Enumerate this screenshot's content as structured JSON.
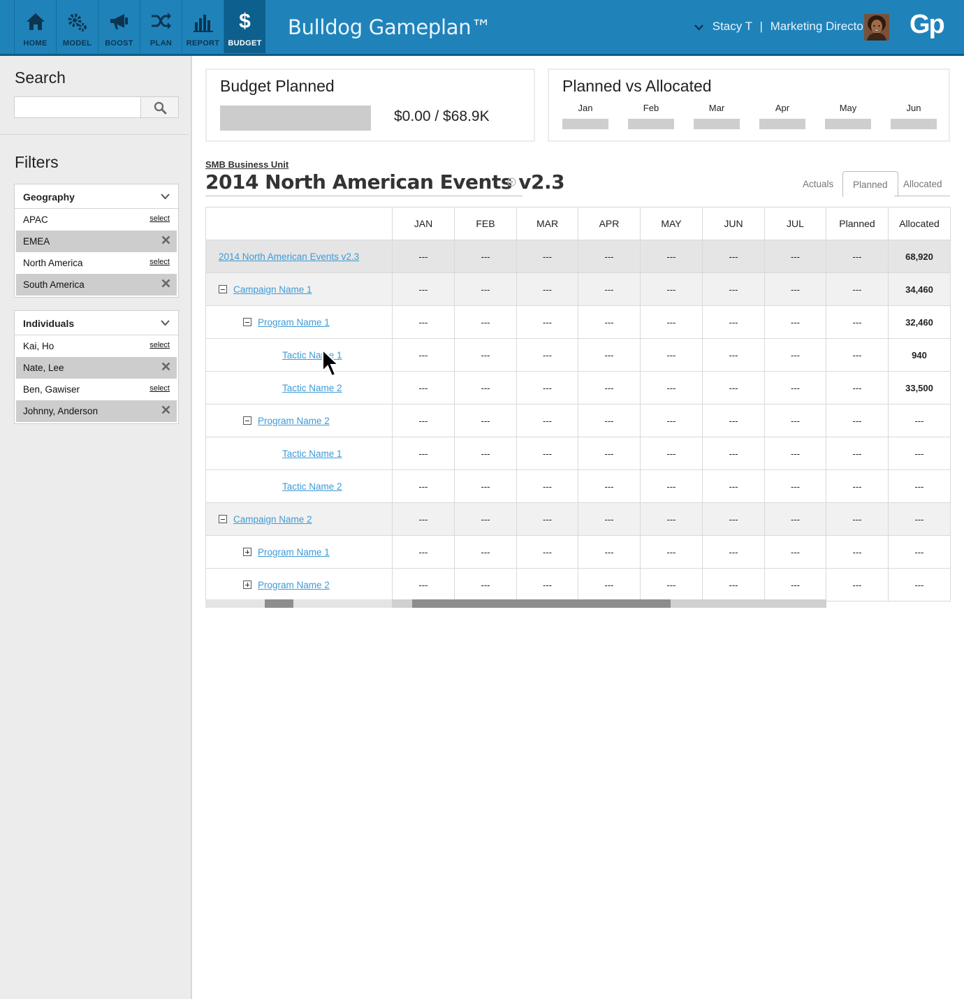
{
  "nav": {
    "items": [
      {
        "label": "HOME",
        "icon": "home-icon"
      },
      {
        "label": "MODEL",
        "icon": "gears-icon"
      },
      {
        "label": "BOOST",
        "icon": "megaphone-icon"
      },
      {
        "label": "PLAN",
        "icon": "shuffle-icon"
      },
      {
        "label": "REPORT",
        "icon": "bar-chart-icon"
      },
      {
        "label": "BUDGET",
        "icon": "dollar-icon"
      }
    ],
    "active": "BUDGET"
  },
  "header": {
    "app_title": "Bulldog Gameplan™",
    "user_name": "Stacy T",
    "separator": "|",
    "user_role": "Marketing Director",
    "logo": "Gp"
  },
  "sidebar": {
    "search_title": "Search",
    "search_placeholder": "",
    "filters_title": "Filters",
    "geography": {
      "title": "Geography",
      "items": [
        {
          "label": "APAC",
          "action": "select",
          "selected": false
        },
        {
          "label": "EMEA",
          "action": "",
          "selected": true
        },
        {
          "label": "North America",
          "action": "select",
          "selected": false
        },
        {
          "label": "South America",
          "action": "",
          "selected": true
        }
      ]
    },
    "individuals": {
      "title": "Individuals",
      "items": [
        {
          "label": "Kai, Ho",
          "action": "select",
          "selected": false
        },
        {
          "label": "Nate, Lee",
          "action": "",
          "selected": true
        },
        {
          "label": "Ben, Gawiser",
          "action": "select",
          "selected": false
        },
        {
          "label": "Johnny, Anderson",
          "action": "",
          "selected": true
        }
      ]
    }
  },
  "budget_planned": {
    "title": "Budget Planned",
    "value": "$0.00 / $68.9K"
  },
  "planned_vs_allocated": {
    "title": "Planned vs Allocated",
    "months": [
      "Jan",
      "Feb",
      "Mar",
      "Apr",
      "May",
      "Jun"
    ]
  },
  "plan": {
    "business_unit": "SMB Business Unit",
    "title": "2014 North American Events v2.3",
    "tabs": [
      "Actuals",
      "Planned",
      "Allocated"
    ],
    "active_tab": "Planned"
  },
  "grid": {
    "columns": [
      "JAN",
      "FEB",
      "MAR",
      "APR",
      "MAY",
      "JUN",
      "JUL",
      "Planned",
      "Allocated"
    ],
    "rows": [
      {
        "name": "2014 North American Events v2.3",
        "level": 0,
        "toggle": "none",
        "style": "top",
        "values": [
          "---",
          "---",
          "---",
          "---",
          "---",
          "---",
          "---",
          "---",
          "68,920"
        ]
      },
      {
        "name": "Campaign Name 1",
        "level": 1,
        "toggle": "minus",
        "style": "shade",
        "values": [
          "---",
          "---",
          "---",
          "---",
          "---",
          "---",
          "---",
          "---",
          "34,460"
        ]
      },
      {
        "name": "Program Name 1",
        "level": 2,
        "toggle": "minus",
        "style": "",
        "values": [
          "---",
          "---",
          "---",
          "---",
          "---",
          "---",
          "---",
          "---",
          "32,460"
        ]
      },
      {
        "name": "Tactic Name 1",
        "level": 3,
        "toggle": "none",
        "style": "",
        "values": [
          "---",
          "---",
          "---",
          "---",
          "---",
          "---",
          "---",
          "---",
          "940"
        ]
      },
      {
        "name": "Tactic Name 2",
        "level": 3,
        "toggle": "none",
        "style": "",
        "values": [
          "---",
          "---",
          "---",
          "---",
          "---",
          "---",
          "---",
          "---",
          "33,500"
        ]
      },
      {
        "name": "Program Name 2",
        "level": 2,
        "toggle": "minus",
        "style": "",
        "values": [
          "---",
          "---",
          "---",
          "---",
          "---",
          "---",
          "---",
          "---",
          "---"
        ]
      },
      {
        "name": "Tactic Name 1",
        "level": 3,
        "toggle": "none",
        "style": "",
        "values": [
          "---",
          "---",
          "---",
          "---",
          "---",
          "---",
          "---",
          "---",
          "---"
        ]
      },
      {
        "name": "Tactic Name 2",
        "level": 3,
        "toggle": "none",
        "style": "",
        "values": [
          "---",
          "---",
          "---",
          "---",
          "---",
          "---",
          "---",
          "---",
          "---"
        ]
      },
      {
        "name": "Campaign Name 2",
        "level": 1,
        "toggle": "minus",
        "style": "shade",
        "values": [
          "---",
          "---",
          "---",
          "---",
          "---",
          "---",
          "---",
          "---",
          "---"
        ]
      },
      {
        "name": "Program Name 1",
        "level": 2,
        "toggle": "plus",
        "style": "",
        "values": [
          "---",
          "---",
          "---",
          "---",
          "---",
          "---",
          "---",
          "---",
          "---"
        ]
      },
      {
        "name": "Program Name 2",
        "level": 2,
        "toggle": "plus",
        "style": "",
        "values": [
          "---",
          "---",
          "---",
          "---",
          "---",
          "---",
          "---",
          "---",
          "---"
        ]
      }
    ]
  },
  "colors": {
    "topbar": "#1f83ba",
    "nav_active": "#0d5f8d",
    "link": "#3c9ad6",
    "sidebar_bg": "#ececec"
  }
}
